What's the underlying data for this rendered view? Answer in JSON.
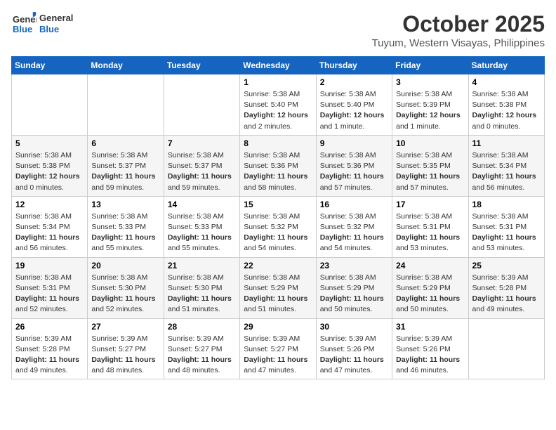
{
  "header": {
    "logo_general": "General",
    "logo_blue": "Blue",
    "month_title": "October 2025",
    "location": "Tuyum, Western Visayas, Philippines"
  },
  "weekdays": [
    "Sunday",
    "Monday",
    "Tuesday",
    "Wednesday",
    "Thursday",
    "Friday",
    "Saturday"
  ],
  "weeks": [
    [
      {
        "day": "",
        "info": ""
      },
      {
        "day": "",
        "info": ""
      },
      {
        "day": "",
        "info": ""
      },
      {
        "day": "1",
        "info": "Sunrise: 5:38 AM\nSunset: 5:40 PM\nDaylight: 12 hours\nand 2 minutes."
      },
      {
        "day": "2",
        "info": "Sunrise: 5:38 AM\nSunset: 5:40 PM\nDaylight: 12 hours\nand 1 minute."
      },
      {
        "day": "3",
        "info": "Sunrise: 5:38 AM\nSunset: 5:39 PM\nDaylight: 12 hours\nand 1 minute."
      },
      {
        "day": "4",
        "info": "Sunrise: 5:38 AM\nSunset: 5:38 PM\nDaylight: 12 hours\nand 0 minutes."
      }
    ],
    [
      {
        "day": "5",
        "info": "Sunrise: 5:38 AM\nSunset: 5:38 PM\nDaylight: 12 hours\nand 0 minutes."
      },
      {
        "day": "6",
        "info": "Sunrise: 5:38 AM\nSunset: 5:37 PM\nDaylight: 11 hours\nand 59 minutes."
      },
      {
        "day": "7",
        "info": "Sunrise: 5:38 AM\nSunset: 5:37 PM\nDaylight: 11 hours\nand 59 minutes."
      },
      {
        "day": "8",
        "info": "Sunrise: 5:38 AM\nSunset: 5:36 PM\nDaylight: 11 hours\nand 58 minutes."
      },
      {
        "day": "9",
        "info": "Sunrise: 5:38 AM\nSunset: 5:36 PM\nDaylight: 11 hours\nand 57 minutes."
      },
      {
        "day": "10",
        "info": "Sunrise: 5:38 AM\nSunset: 5:35 PM\nDaylight: 11 hours\nand 57 minutes."
      },
      {
        "day": "11",
        "info": "Sunrise: 5:38 AM\nSunset: 5:34 PM\nDaylight: 11 hours\nand 56 minutes."
      }
    ],
    [
      {
        "day": "12",
        "info": "Sunrise: 5:38 AM\nSunset: 5:34 PM\nDaylight: 11 hours\nand 56 minutes."
      },
      {
        "day": "13",
        "info": "Sunrise: 5:38 AM\nSunset: 5:33 PM\nDaylight: 11 hours\nand 55 minutes."
      },
      {
        "day": "14",
        "info": "Sunrise: 5:38 AM\nSunset: 5:33 PM\nDaylight: 11 hours\nand 55 minutes."
      },
      {
        "day": "15",
        "info": "Sunrise: 5:38 AM\nSunset: 5:32 PM\nDaylight: 11 hours\nand 54 minutes."
      },
      {
        "day": "16",
        "info": "Sunrise: 5:38 AM\nSunset: 5:32 PM\nDaylight: 11 hours\nand 54 minutes."
      },
      {
        "day": "17",
        "info": "Sunrise: 5:38 AM\nSunset: 5:31 PM\nDaylight: 11 hours\nand 53 minutes."
      },
      {
        "day": "18",
        "info": "Sunrise: 5:38 AM\nSunset: 5:31 PM\nDaylight: 11 hours\nand 53 minutes."
      }
    ],
    [
      {
        "day": "19",
        "info": "Sunrise: 5:38 AM\nSunset: 5:31 PM\nDaylight: 11 hours\nand 52 minutes."
      },
      {
        "day": "20",
        "info": "Sunrise: 5:38 AM\nSunset: 5:30 PM\nDaylight: 11 hours\nand 52 minutes."
      },
      {
        "day": "21",
        "info": "Sunrise: 5:38 AM\nSunset: 5:30 PM\nDaylight: 11 hours\nand 51 minutes."
      },
      {
        "day": "22",
        "info": "Sunrise: 5:38 AM\nSunset: 5:29 PM\nDaylight: 11 hours\nand 51 minutes."
      },
      {
        "day": "23",
        "info": "Sunrise: 5:38 AM\nSunset: 5:29 PM\nDaylight: 11 hours\nand 50 minutes."
      },
      {
        "day": "24",
        "info": "Sunrise: 5:38 AM\nSunset: 5:29 PM\nDaylight: 11 hours\nand 50 minutes."
      },
      {
        "day": "25",
        "info": "Sunrise: 5:39 AM\nSunset: 5:28 PM\nDaylight: 11 hours\nand 49 minutes."
      }
    ],
    [
      {
        "day": "26",
        "info": "Sunrise: 5:39 AM\nSunset: 5:28 PM\nDaylight: 11 hours\nand 49 minutes."
      },
      {
        "day": "27",
        "info": "Sunrise: 5:39 AM\nSunset: 5:27 PM\nDaylight: 11 hours\nand 48 minutes."
      },
      {
        "day": "28",
        "info": "Sunrise: 5:39 AM\nSunset: 5:27 PM\nDaylight: 11 hours\nand 48 minutes."
      },
      {
        "day": "29",
        "info": "Sunrise: 5:39 AM\nSunset: 5:27 PM\nDaylight: 11 hours\nand 47 minutes."
      },
      {
        "day": "30",
        "info": "Sunrise: 5:39 AM\nSunset: 5:26 PM\nDaylight: 11 hours\nand 47 minutes."
      },
      {
        "day": "31",
        "info": "Sunrise: 5:39 AM\nSunset: 5:26 PM\nDaylight: 11 hours\nand 46 minutes."
      },
      {
        "day": "",
        "info": ""
      }
    ]
  ]
}
